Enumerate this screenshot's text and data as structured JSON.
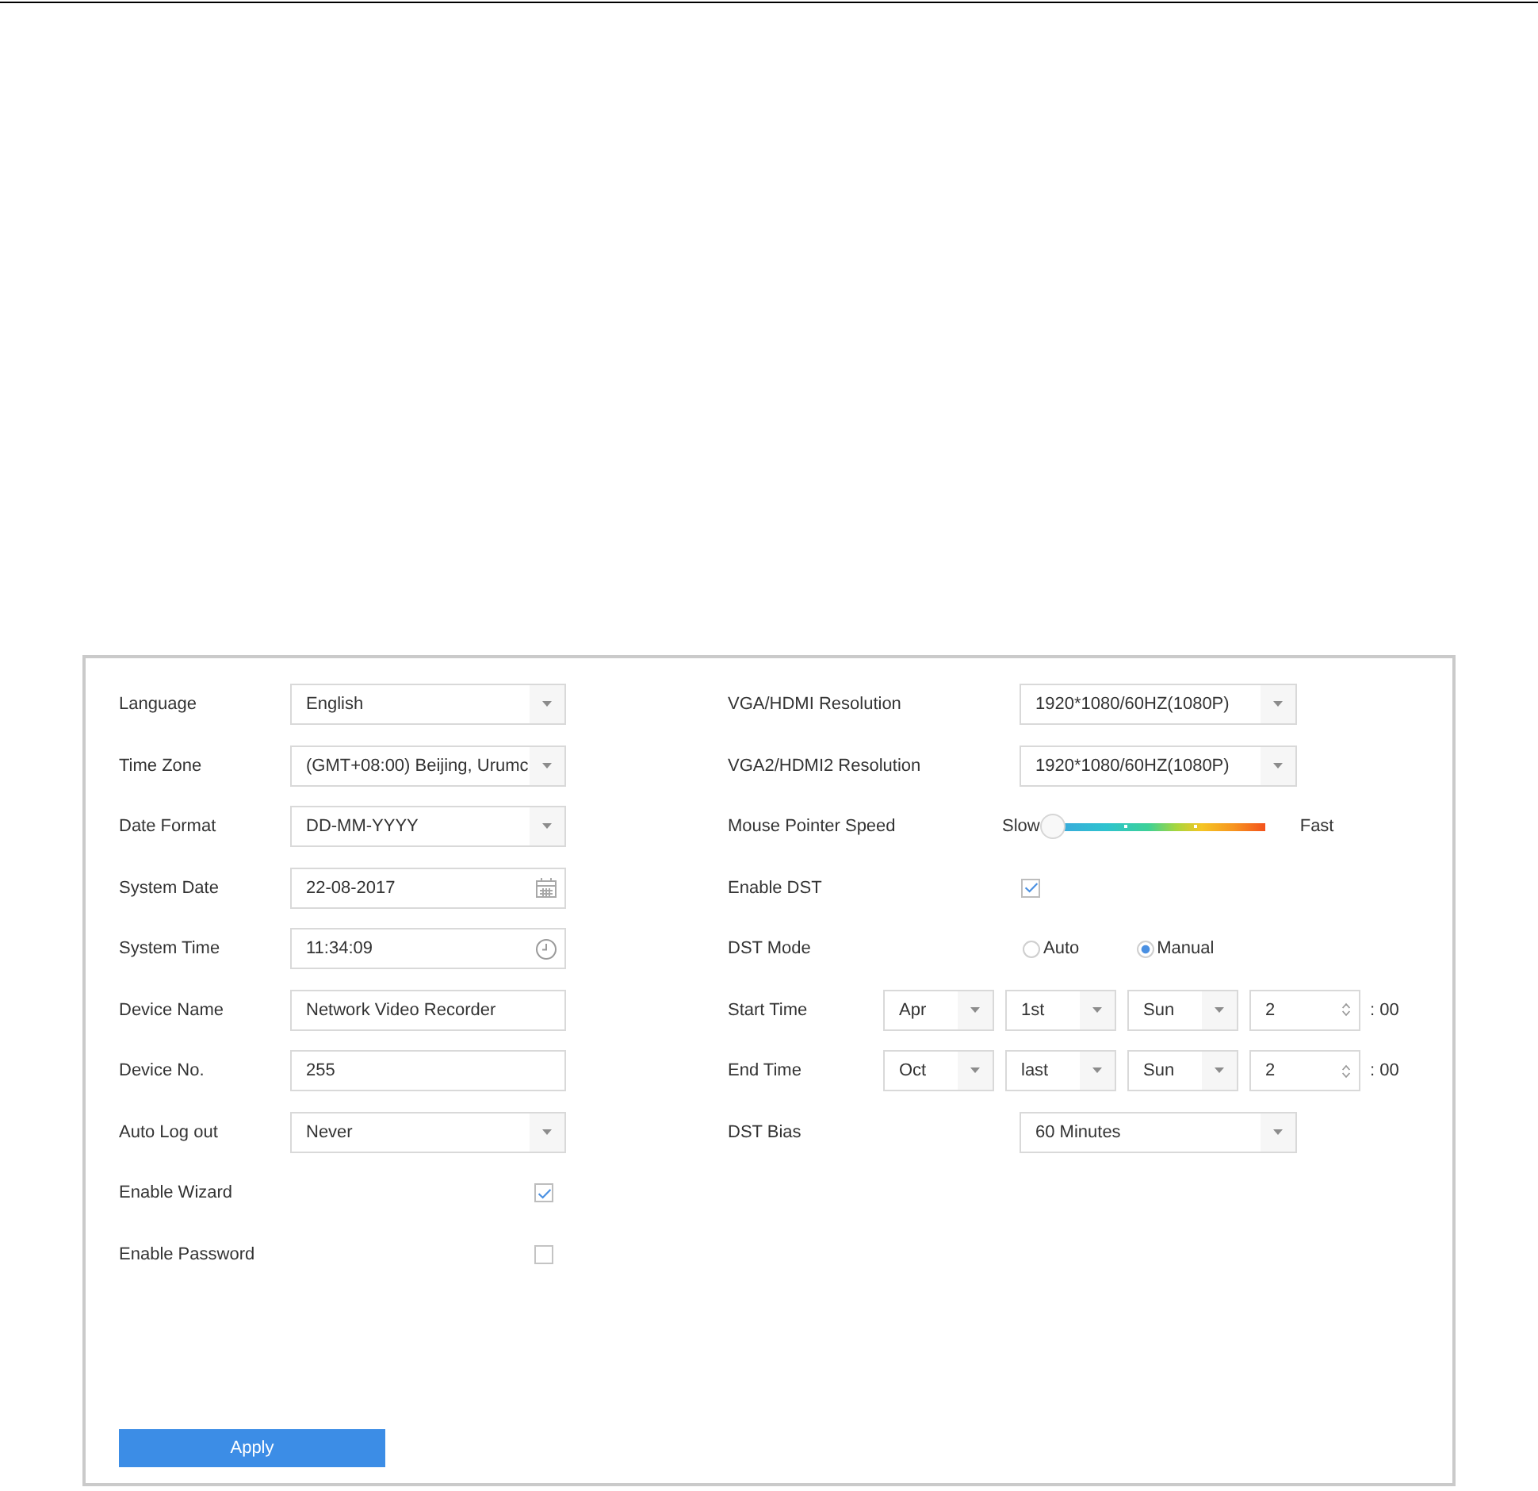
{
  "left_settings": [
    {
      "kind": "select",
      "label": "Language",
      "value": "English"
    },
    {
      "kind": "select",
      "label": "Time Zone",
      "value": "(GMT+08:00) Beijing, Urumc"
    },
    {
      "kind": "select",
      "label": "Date Format",
      "value": "DD-MM-YYYY"
    },
    {
      "kind": "date",
      "label": "System Date",
      "value": "22-08-2017"
    },
    {
      "kind": "time",
      "label": "System Time",
      "value": "11:34:09"
    },
    {
      "kind": "text",
      "label": "Device Name",
      "value": "Network Video Recorder"
    },
    {
      "kind": "text",
      "label": "Device No.",
      "value": "255"
    },
    {
      "kind": "select",
      "label": "Auto Log out",
      "value": "Never"
    },
    {
      "kind": "checkbox",
      "label": "Enable Wizard",
      "checked": true
    },
    {
      "kind": "checkbox",
      "label": "Enable Password",
      "checked": false
    }
  ],
  "right_settings": [
    {
      "kind": "select",
      "label": "VGA/HDMI Resolution",
      "value": "1920*1080/60HZ(1080P)"
    },
    {
      "kind": "select",
      "label": "VGA2/HDMI2 Resolution",
      "value": "1920*1080/60HZ(1080P)"
    },
    {
      "kind": "slider",
      "label": "Mouse Pointer Speed",
      "min_label": "Slow",
      "max_label": "Fast",
      "level": 0
    },
    {
      "kind": "checkbox",
      "label": "Enable DST",
      "checked": true
    },
    {
      "kind": "radio",
      "label": "DST Mode",
      "options": [
        {
          "label": "Auto",
          "selected": false
        },
        {
          "label": "Manual",
          "selected": true
        }
      ]
    },
    {
      "kind": "schedule",
      "label": "Start Time",
      "selects": [
        "Apr",
        "1st",
        "Sun"
      ],
      "hour": "2",
      "minutes": ": 00"
    },
    {
      "kind": "schedule",
      "label": "End Time",
      "selects": [
        "Oct",
        "last",
        "Sun"
      ],
      "hour": "2",
      "minutes": ": 00"
    },
    {
      "kind": "select",
      "label": "DST Bias",
      "value": "60 Minutes"
    }
  ],
  "apply_button": {
    "label": "Apply"
  }
}
